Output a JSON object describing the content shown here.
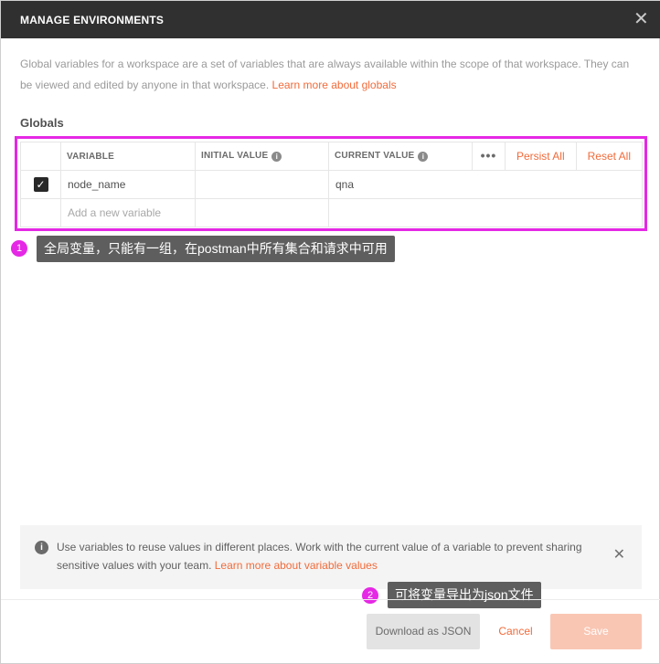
{
  "header": {
    "title": "MANAGE ENVIRONMENTS",
    "close_glyph": "✕"
  },
  "description": {
    "text": "Global variables for a workspace are a set of variables that are always available within the scope of that workspace. They can be viewed and edited by anyone in that workspace. ",
    "link": "Learn more about globals"
  },
  "globals": {
    "title": "Globals",
    "columns": {
      "variable": "VARIABLE",
      "initial_value": "INITIAL VALUE",
      "current_value": "CURRENT VALUE"
    },
    "actions": {
      "more": "•••",
      "persist_all": "Persist All",
      "reset_all": "Reset All"
    },
    "rows": [
      {
        "checked": true,
        "variable": "node_name",
        "initial_value": "",
        "current_value": "qna"
      }
    ],
    "new_row_placeholder": "Add a new variable"
  },
  "annotations": [
    {
      "number": "1",
      "text": "全局变量，只能有一组，在postman中所有集合和请求中可用"
    },
    {
      "number": "2",
      "text": "可将变量导出为json文件"
    }
  ],
  "info_banner": {
    "text": "Use variables to reuse values in different places. Work with the current value of a variable to prevent sharing sensitive values with your team. ",
    "link": "Learn more about variable values"
  },
  "footer": {
    "download_label": "Download as JSON",
    "cancel_label": "Cancel",
    "save_label": "Save"
  },
  "colors": {
    "accent": "#f26b3a",
    "header_bg": "#303030",
    "annotation": "#e528e5",
    "save_disabled": "#f9c6b4"
  },
  "icons": {
    "info": "info-icon",
    "close": "close-icon",
    "checkbox": "checkbox-checked-icon",
    "more": "more-dots-icon"
  }
}
